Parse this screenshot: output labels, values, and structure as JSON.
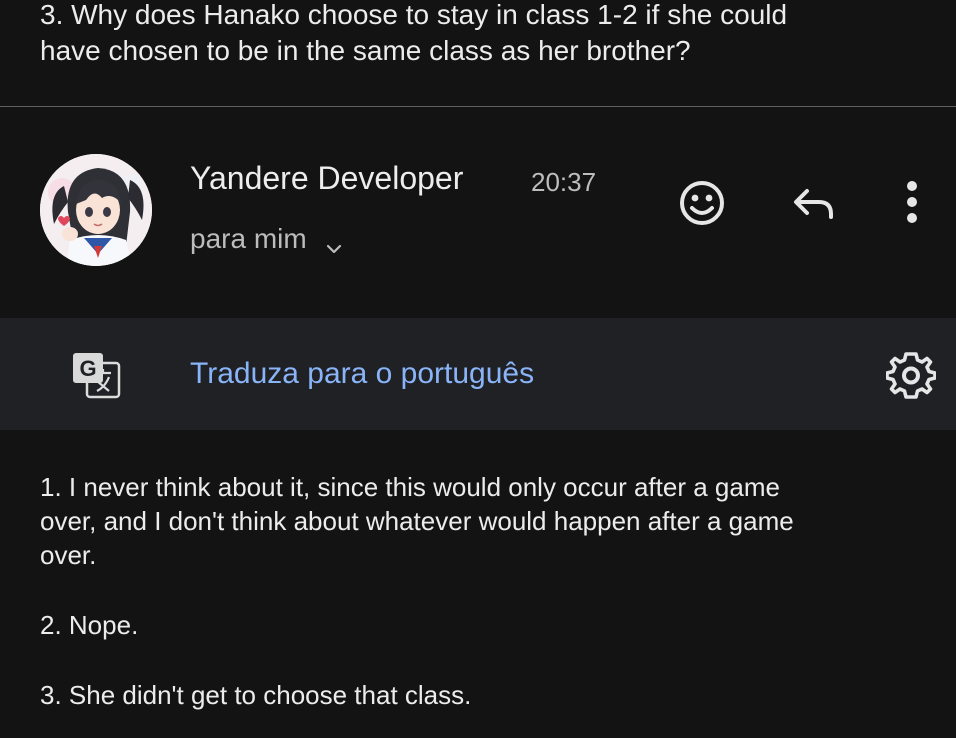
{
  "quoted_question": {
    "line1": "3. Why does Hanako choose to stay in class 1-2 if she could",
    "line2": "have chosen to be in the same class as her brother?"
  },
  "email_header": {
    "sender_name": "Yandere Developer",
    "time": "20:37",
    "recipient_label": "para mim"
  },
  "icons": {
    "avatar": "avatar-anime-girl",
    "emoji": "smiley-icon",
    "reply": "reply-arrow-icon",
    "more": "vertical-dots-icon",
    "translate": "google-translate-icon",
    "settings": "gear-icon",
    "chevron": "chevron-down-icon"
  },
  "translate_bar": {
    "link_label": "Traduza para o português"
  },
  "message_body": {
    "p1_line1": "1. I never think about it, since this would only occur after a game",
    "p1_line2": "over, and I don't think about whatever would happen after a game",
    "p1_line3": "over.",
    "p2": "2. Nope.",
    "p3": "3. She didn't get to choose that class."
  },
  "colors": {
    "background": "#131313",
    "translate_bar": "#1f2124",
    "link": "#8ab4f8",
    "text": "#ececec",
    "muted": "#bcbcbc"
  }
}
